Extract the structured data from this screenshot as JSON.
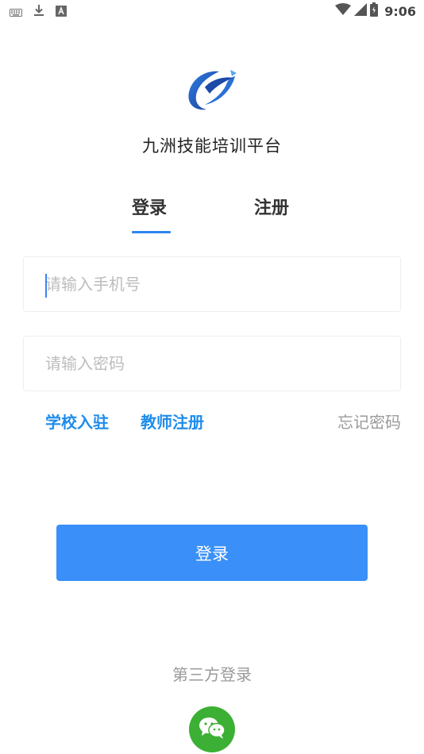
{
  "status_bar": {
    "time": "9:06",
    "left_icons": [
      "keyboard-icon",
      "download-icon",
      "a-icon"
    ],
    "right_icons": [
      "wifi-icon",
      "signal-icon",
      "battery-icon"
    ]
  },
  "app": {
    "title": "九洲技能培训平台",
    "logo": "logo-icon"
  },
  "tabs": {
    "login_label": "登录",
    "register_label": "注册",
    "active": "login"
  },
  "form": {
    "phone_placeholder": "请输入手机号",
    "phone_value": "",
    "password_placeholder": "请输入密码",
    "password_value": ""
  },
  "links": {
    "school": "学校入驻",
    "teacher": "教师注册",
    "forgot": "忘记密码"
  },
  "login_button": "登录",
  "third_party": {
    "title": "第三方登录",
    "icon": "wechat-icon"
  },
  "colors": {
    "accent": "#2f86f0",
    "button": "#3a90f8",
    "link": "#1f8ceb",
    "wechat": "#3cb034"
  }
}
